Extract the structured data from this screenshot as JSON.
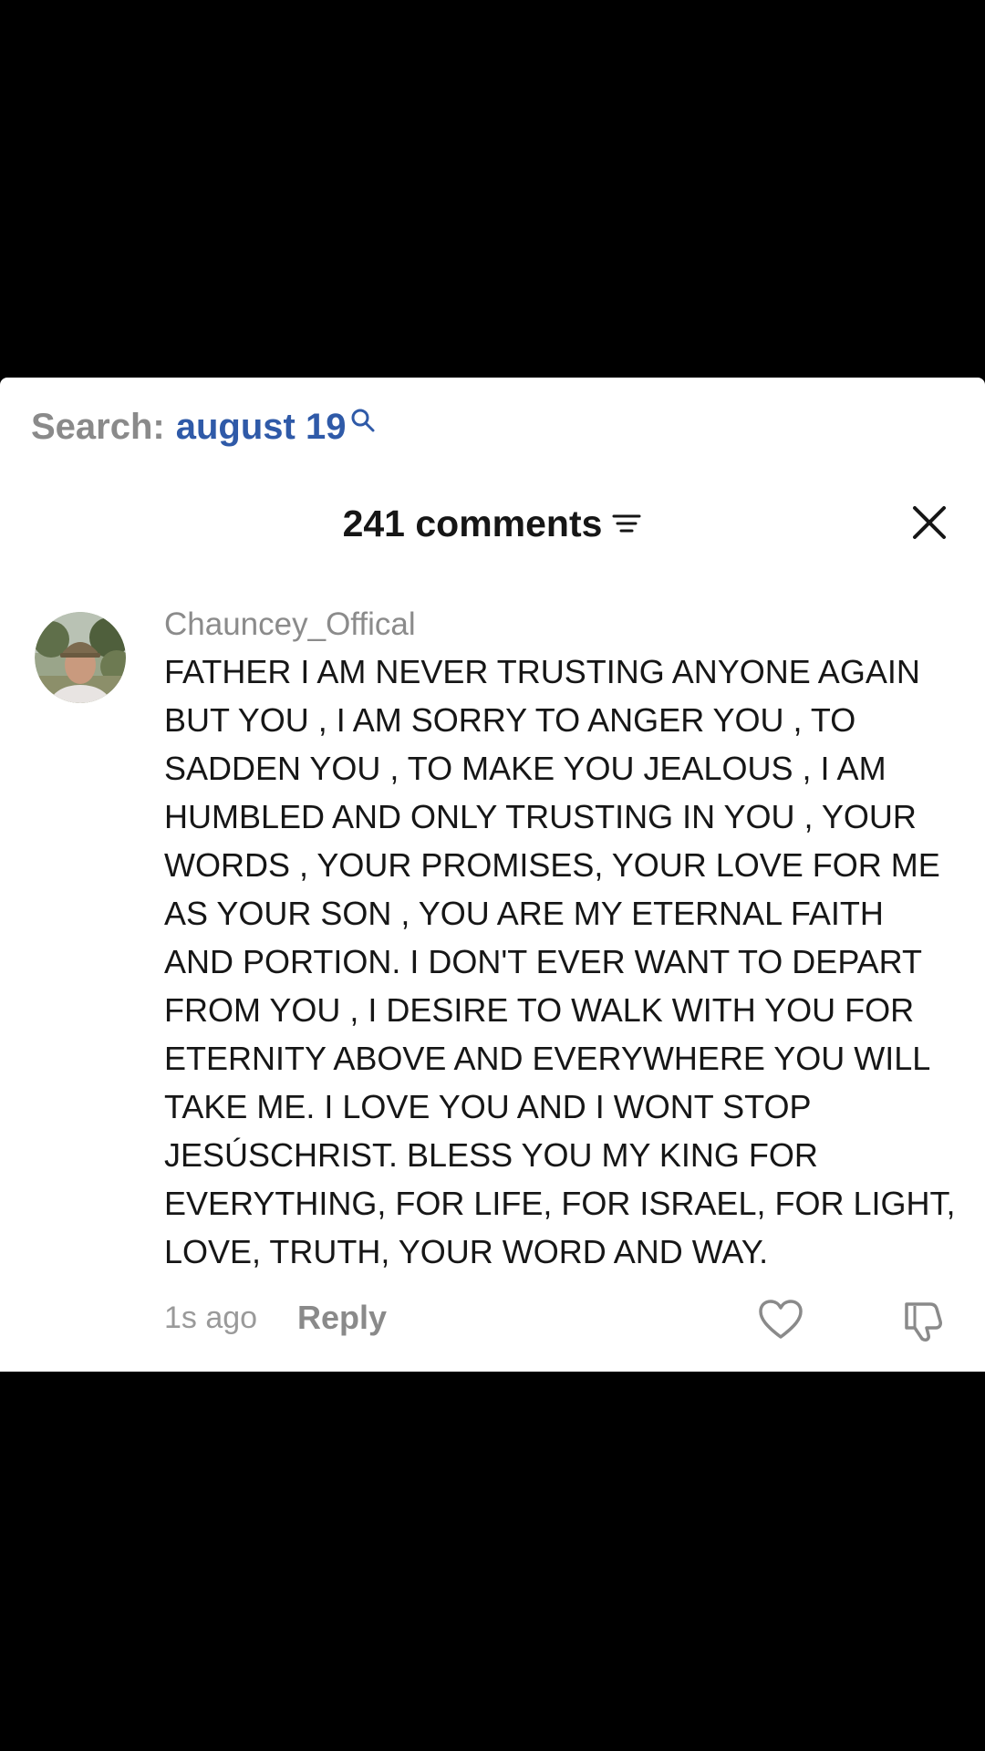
{
  "search": {
    "prefix": "Search:",
    "query": "august 19"
  },
  "comments_header": {
    "count_label": "241 comments"
  },
  "icons": {
    "search": "search-icon",
    "sort": "sort-filter-icon",
    "close": "close-icon",
    "like": "heart-outline-icon",
    "dislike": "thumbs-down-outline-icon"
  },
  "comment": {
    "username": "Chauncey_Offical",
    "text": "FATHER I AM NEVER TRUSTING ANYONE AGAIN BUT YOU , I AM SORRY TO ANGER YOU , TO SADDEN YOU , TO MAKE YOU JEALOUS , I AM HUMBLED AND ONLY TRUSTING IN YOU , YOUR WORDS , YOUR PROMISES, YOUR LOVE FOR ME AS YOUR SON , YOU ARE MY ETERNAL FAITH AND PORTION. I DON'T EVER WANT TO DEPART FROM YOU , I DESIRE TO WALK WITH YOU FOR ETERNITY ABOVE AND EVERYWHERE YOU WILL TAKE ME. I LOVE YOU AND I WONT STOP JESÚSCHRIST. BLESS YOU MY KING FOR EVERYTHING, FOR LIFE, FOR ISRAEL, FOR LIGHT, LOVE, TRUTH, YOUR WORD AND WAY.",
    "timestamp": "1s ago",
    "reply_label": "Reply"
  },
  "colors": {
    "background": "#000000",
    "sheet": "#ffffff",
    "search_query": "#2f5aa8",
    "muted_text": "#8a8a8a",
    "body_text": "#161616"
  }
}
